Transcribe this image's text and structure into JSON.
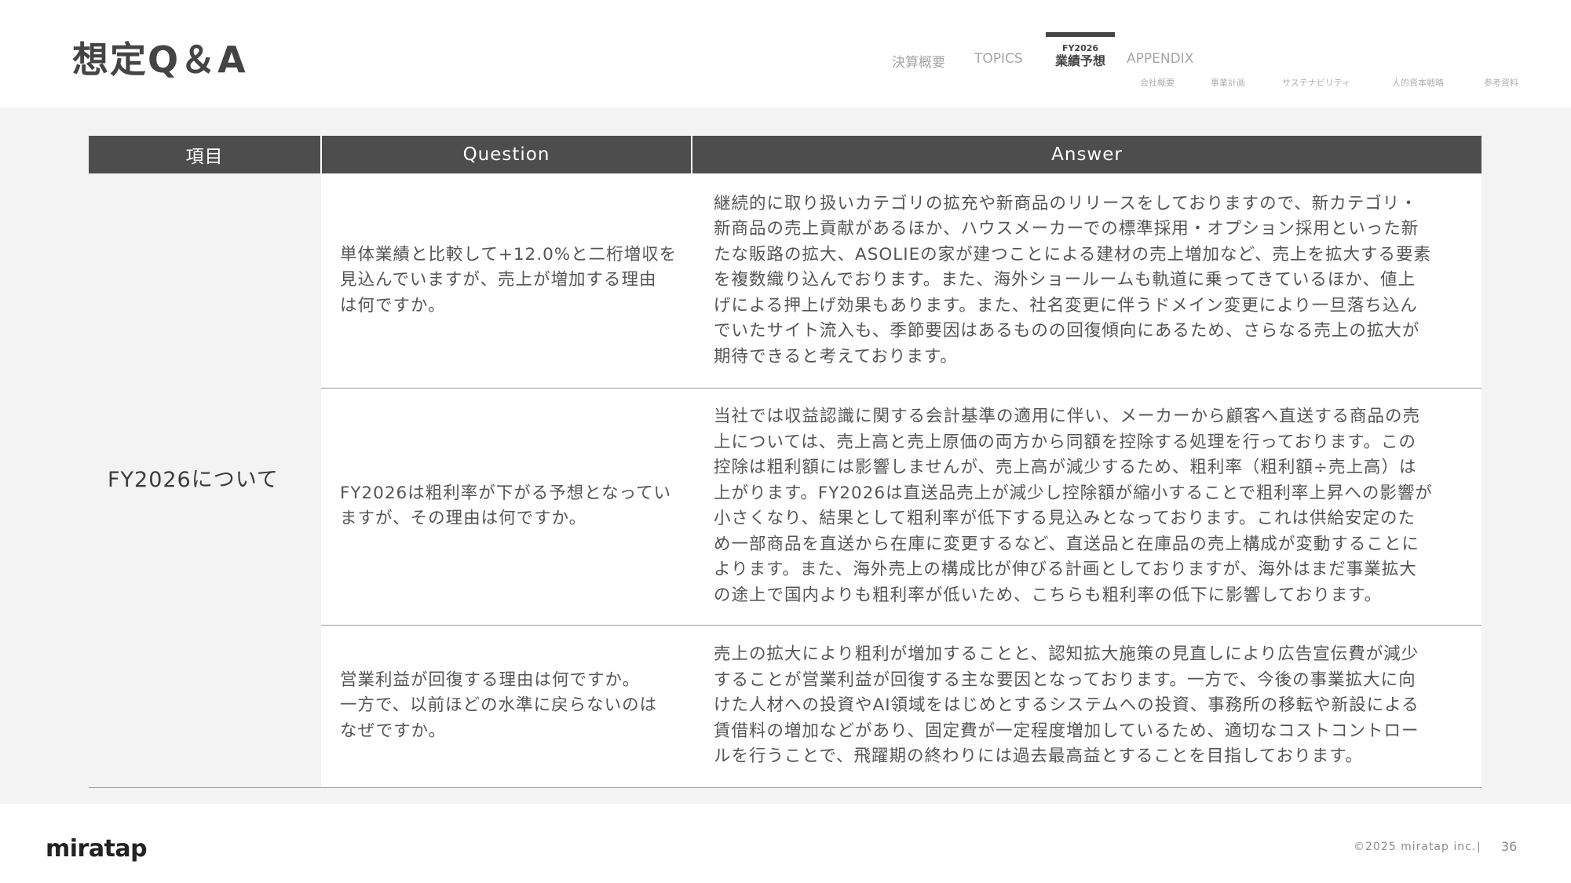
{
  "header": {
    "title": "想定Q＆A",
    "nav": [
      {
        "label": "決算概要",
        "active": false
      },
      {
        "label": "TOPICS",
        "active": false
      },
      {
        "label_small": "FY2026",
        "label": "業績予想",
        "active": true
      },
      {
        "label": "APPENDIX",
        "active": false
      }
    ],
    "subnav": [
      "会社概要",
      "事業計画",
      "サステナビリティ",
      "人的資本戦略",
      "参考資料"
    ]
  },
  "table": {
    "headers": [
      "項目",
      "Question",
      "Answer"
    ],
    "category": "FY2026について",
    "rows": [
      {
        "question": "単体業績と比較して+12.0%と二桁増収を\n見込んでいますが、売上が増加する理由\nは何ですか。",
        "answer": "継続的に取り扱いカテゴリの拡充や新商品のリリースをしておりますので、新カテゴリ・\n新商品の売上貢献があるほか、ハウスメーカーでの標準採用・オプション採用といった新\nたな販路の拡大、ASOLIEの家が建つことによる建材の売上増加など、売上を拡大する要素\nを複数織り込んでおります。また、海外ショールームも軌道に乗ってきているほか、値上\nげによる押上げ効果もあります。また、社名変更に伴うドメイン変更により一旦落ち込ん\nでいたサイト流入も、季節要因はあるものの回復傾向にあるため、さらなる売上の拡大が\n期待できると考えております。"
      },
      {
        "question": "FY2026は粗利率が下がる予想となってい\nますが、その理由は何ですか。",
        "answer": "当社では収益認識に関する会計基準の適用に伴い、メーカーから顧客へ直送する商品の売\n上については、売上高と売上原価の両方から同額を控除する処理を行っております。この\n控除は粗利額には影響しませんが、売上高が減少するため、粗利率（粗利額÷売上高）は\n上がります。FY2026は直送品売上が減少し控除額が縮小することで粗利率上昇への影響が\n小さくなり、結果として粗利率が低下する見込みとなっております。これは供給安定のた\nめ一部商品を直送から在庫に変更するなど、直送品と在庫品の売上構成が変動することに\nよります。また、海外売上の構成比が伸びる計画としておりますが、海外はまだ事業拡大\nの途上で国内よりも粗利率が低いため、こちらも粗利率の低下に影響しております。"
      },
      {
        "question": "営業利益が回復する理由は何ですか。\n一方で、以前ほどの水準に戻らないのは\nなぜですか。",
        "answer": "売上の拡大により粗利が増加することと、認知拡大施策の見直しにより広告宣伝費が減少\nすることが営業利益が回復する主な要因となっております。一方で、今後の事業拡大に向\nけた人材への投資やAI領域をはじめとするシステムへの投資、事務所の移転や新設による\n賃借料の増加などがあり、固定費が一定程度増加しているため、適切なコストコントロー\nルを行うことで、飛躍期の終わりには過去最高益とすることを目指しております。"
      }
    ]
  },
  "footer": {
    "logo": "miratap",
    "copyright": "©2025 miratap inc.",
    "separator": "|",
    "page_number": "36"
  }
}
